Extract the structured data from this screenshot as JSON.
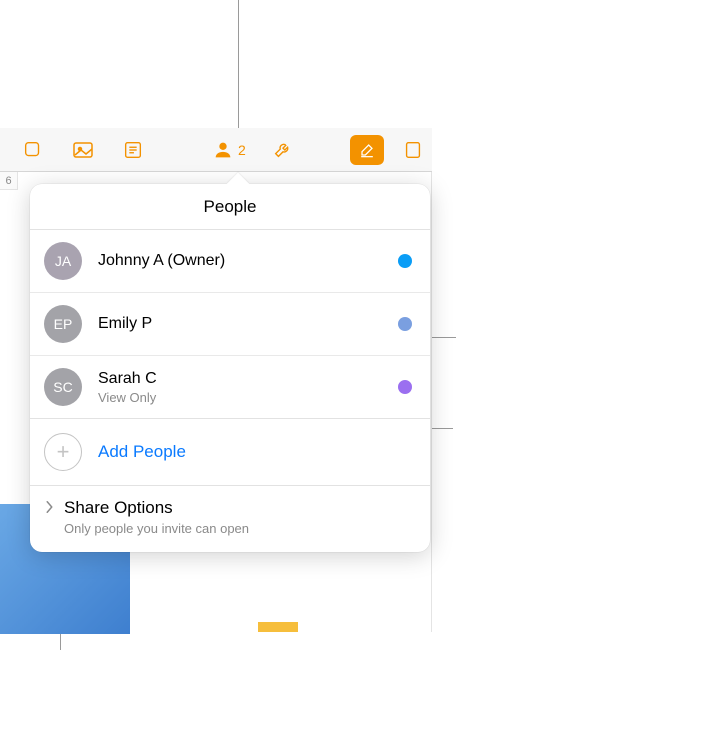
{
  "toolbar": {
    "people_count": "2"
  },
  "popover": {
    "title": "People",
    "people": [
      {
        "initials": "JA",
        "name": "Johnny A (Owner)",
        "sub": "",
        "avatar": "#a9a3b0",
        "dot": "#0a9df6"
      },
      {
        "initials": "EP",
        "name": "Emily P",
        "sub": "",
        "avatar": "#a3a3a8",
        "dot": "#7a9fe0"
      },
      {
        "initials": "SC",
        "name": "Sarah C",
        "sub": "View Only",
        "avatar": "#a3a3a8",
        "dot": "#9b6ff0"
      }
    ],
    "add_label": "Add People",
    "share": {
      "title": "Share Options",
      "sub": "Only people you invite can open"
    }
  },
  "sheet": {
    "row_label": "6"
  }
}
